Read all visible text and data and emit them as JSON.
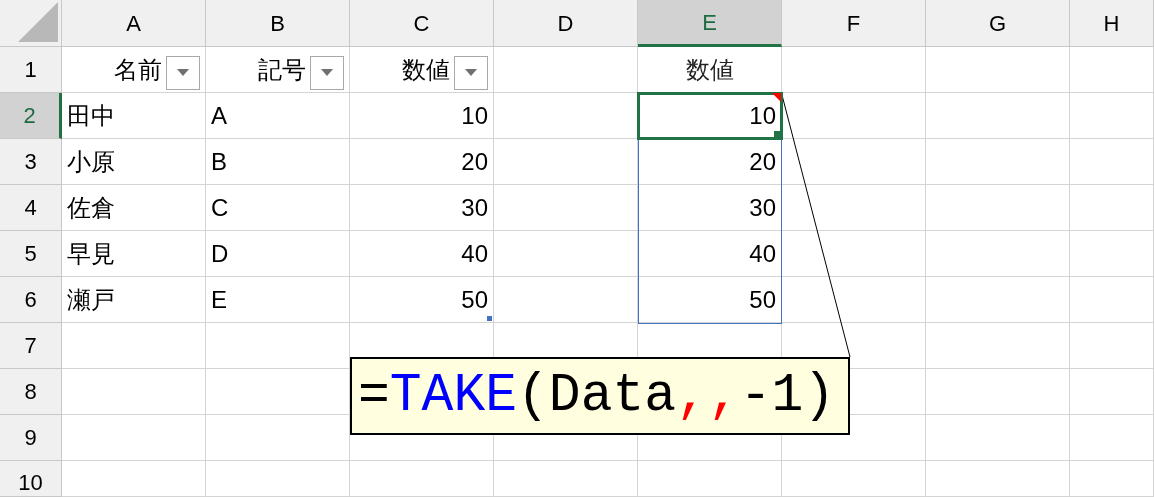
{
  "column_headers": [
    {
      "label": "A",
      "selected": false
    },
    {
      "label": "B",
      "selected": false
    },
    {
      "label": "C",
      "selected": false
    },
    {
      "label": "D",
      "selected": false
    },
    {
      "label": "E",
      "selected": true
    },
    {
      "label": "F",
      "selected": false
    },
    {
      "label": "G",
      "selected": false
    },
    {
      "label": "H",
      "selected": false
    }
  ],
  "row_headers": [
    {
      "label": "1",
      "selected": false
    },
    {
      "label": "2",
      "selected": true
    },
    {
      "label": "3",
      "selected": false
    },
    {
      "label": "4",
      "selected": false
    },
    {
      "label": "5",
      "selected": false
    },
    {
      "label": "6",
      "selected": false
    },
    {
      "label": "7",
      "selected": false
    },
    {
      "label": "8",
      "selected": false
    },
    {
      "label": "9",
      "selected": false
    },
    {
      "label": "10",
      "selected": false
    }
  ],
  "table": {
    "columns": [
      {
        "label": "名前",
        "filter": true
      },
      {
        "label": "記号",
        "filter": true
      },
      {
        "label": "数値",
        "filter": true
      }
    ],
    "rows": [
      [
        "田中",
        "A",
        "10"
      ],
      [
        "小原",
        "B",
        "20"
      ],
      [
        "佐倉",
        "C",
        "30"
      ],
      [
        "早見",
        "D",
        "40"
      ],
      [
        "瀬戸",
        "E",
        "50"
      ]
    ]
  },
  "spill": {
    "header": "数値",
    "cells": [
      {
        "value": "10",
        "selected": true,
        "comment": true
      },
      {
        "value": "20",
        "selected": false,
        "comment": false
      },
      {
        "value": "30",
        "selected": false,
        "comment": false
      },
      {
        "value": "40",
        "selected": false,
        "comment": false
      },
      {
        "value": "50",
        "selected": false,
        "comment": false
      }
    ]
  },
  "callout": {
    "formula": [
      {
        "text": "=",
        "color": "#000000"
      },
      {
        "text": "TAKE",
        "color": "#0000ff"
      },
      {
        "text": "(Data",
        "color": "#000000"
      },
      {
        "text": ",,",
        "color": "#ff0000"
      },
      {
        "text": "-1)",
        "color": "#000000"
      }
    ]
  }
}
